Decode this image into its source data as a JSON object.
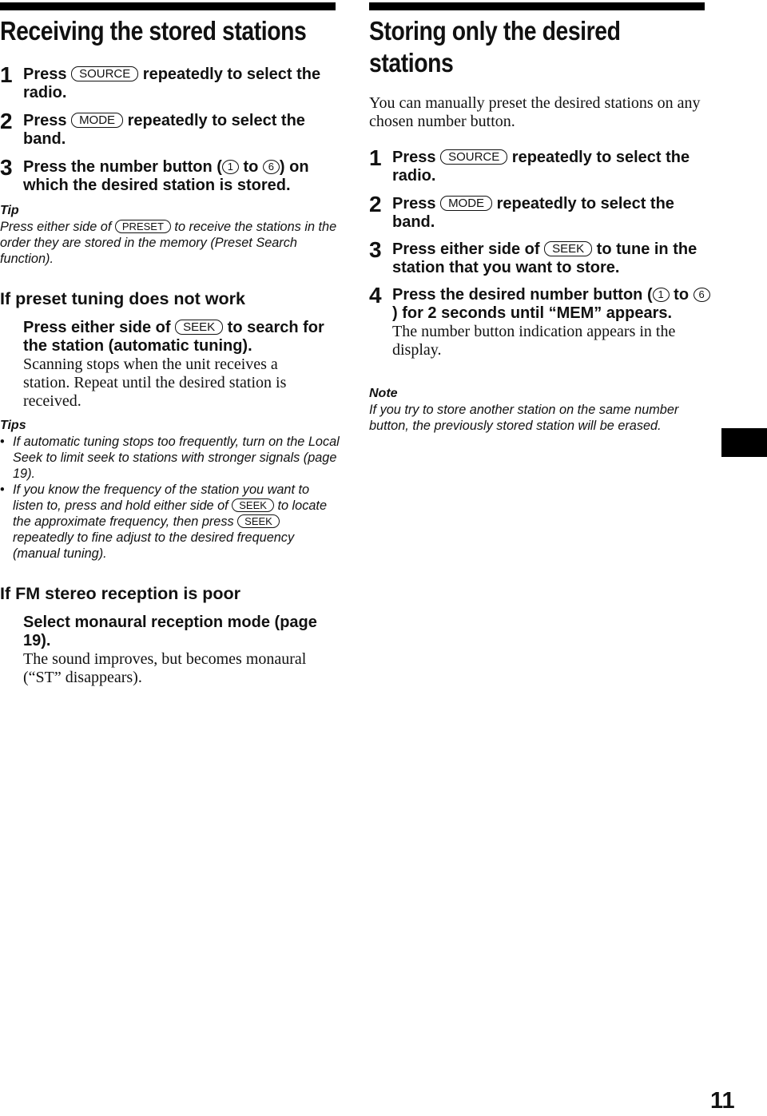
{
  "left": {
    "title": "Receiving the stored stations",
    "steps": [
      {
        "num": "1",
        "pre": "Press ",
        "key": "SOURCE",
        "post": " repeatedly to select the radio."
      },
      {
        "num": "2",
        "pre": "Press ",
        "key": "MODE",
        "post": " repeatedly to select the band."
      },
      {
        "num": "3",
        "pre": "Press the number button (",
        "key_a": "1",
        "mid": " to ",
        "key_b": "6",
        "post": ") on which the desired station is stored."
      }
    ],
    "tip": {
      "label": "Tip",
      "pre": "Press either side of ",
      "key": "PRESET",
      "post": " to receive the stations in the order they are stored in the memory (Preset Search function)."
    },
    "preset_section": {
      "heading": "If preset tuning does not work",
      "instr_pre": "Press either side of ",
      "instr_key": "SEEK",
      "instr_post": " to search for the station (automatic tuning).",
      "body": "Scanning stops when the unit receives a station. Repeat until the desired station is received."
    },
    "tips": {
      "label": "Tips",
      "items": [
        {
          "text": "If automatic tuning stops too frequently, turn on the Local Seek to limit seek to stations with stronger signals (page 19)."
        },
        {
          "pre": "If you know the frequency of the station you want to listen to, press and hold either side of ",
          "key_a": "SEEK",
          "mid": " to locate the approximate frequency, then press ",
          "key_b": "SEEK",
          "post": " repeatedly to fine adjust to the desired frequency (manual tuning)."
        }
      ]
    },
    "fm_section": {
      "heading": "If FM stereo reception is poor",
      "instr": "Select monaural reception mode (page 19).",
      "body": "The sound improves, but becomes monaural (“ST” disappears)."
    }
  },
  "right": {
    "title_line1": "Storing only the desired",
    "title_line2": "stations",
    "intro": "You can manually preset the desired stations on any chosen number button.",
    "steps": [
      {
        "num": "1",
        "pre": "Press ",
        "key": "SOURCE",
        "post": " repeatedly to select the radio."
      },
      {
        "num": "2",
        "pre": "Press ",
        "key": "MODE",
        "post": " repeatedly to select the band."
      },
      {
        "num": "3",
        "pre": "Press either side of ",
        "key": "SEEK",
        "post": " to tune in the station that you want to store."
      },
      {
        "num": "4",
        "pre": "Press the desired number button (",
        "key_a": "1",
        "mid": " to ",
        "key_b": "6",
        "post": ") for 2 seconds until “MEM” appears.",
        "body": "The number button indication appears in the display."
      }
    ],
    "note": {
      "label": "Note",
      "text": "If you try to store another station on the same number button, the previously stored station will be erased."
    }
  },
  "page_number": "11"
}
